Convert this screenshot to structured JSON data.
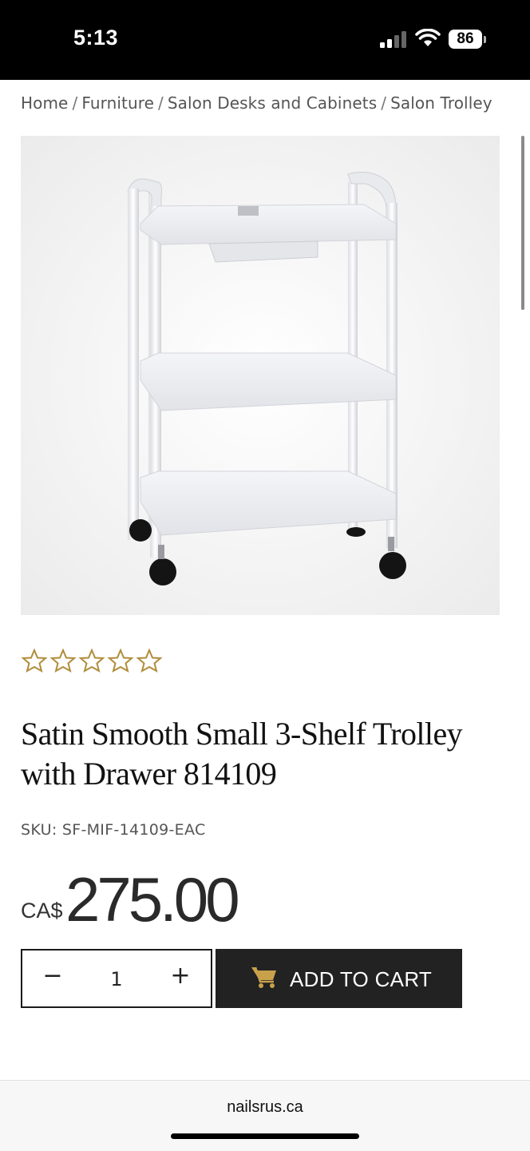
{
  "status_bar": {
    "time": "5:13",
    "battery": "86",
    "icons": [
      "signal-icon",
      "wifi-icon",
      "battery-icon"
    ]
  },
  "breadcrumb": {
    "items": [
      "Home",
      "Furniture",
      "Salon Desks and Cabinets",
      "Salon Trolley"
    ],
    "separator": "/"
  },
  "product": {
    "image_alt_icon": "product-photo",
    "rating": {
      "stars_filled": 0,
      "stars_total": 5,
      "color": "#b08d3a"
    },
    "title_line1": "Satin Smooth Small 3-Shelf Trolley",
    "title_line2": "with Drawer 814109",
    "sku": "SKU: SF-MIF-14109-EAC",
    "price_currency": "CA$",
    "price_value": "275.00"
  },
  "purchase": {
    "minus_label": "−",
    "quantity": "1",
    "plus_label": "+",
    "add_to_cart_label": "ADD TO CART",
    "cart_icon_color": "#c9a14a",
    "button_color": "#222222"
  },
  "browser": {
    "url": "nailsrus.ca"
  }
}
